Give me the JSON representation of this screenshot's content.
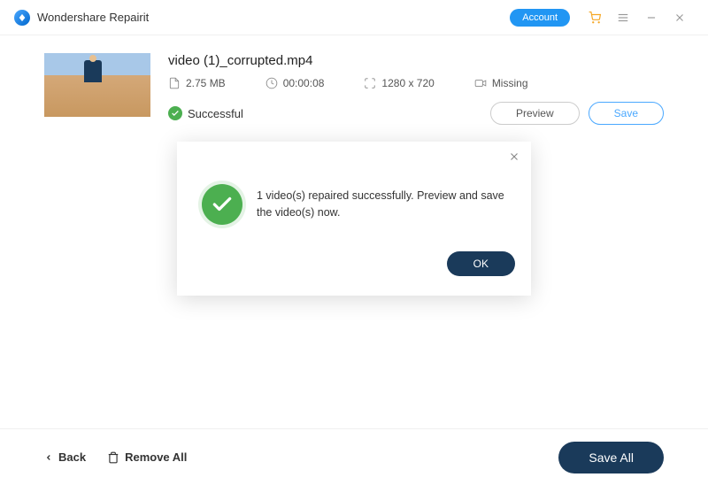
{
  "titlebar": {
    "app_name": "Wondershare Repairit",
    "account_label": "Account"
  },
  "video": {
    "filename": "video (1)_corrupted.mp4",
    "size": "2.75  MB",
    "duration": "00:00:08",
    "resolution": "1280 x 720",
    "device": "Missing",
    "status": "Successful",
    "preview_label": "Preview",
    "save_label": "Save"
  },
  "modal": {
    "message": "1 video(s) repaired successfully. Preview and save the video(s) now.",
    "ok_label": "OK"
  },
  "footer": {
    "back_label": "Back",
    "remove_all_label": "Remove All",
    "save_all_label": "Save All"
  }
}
